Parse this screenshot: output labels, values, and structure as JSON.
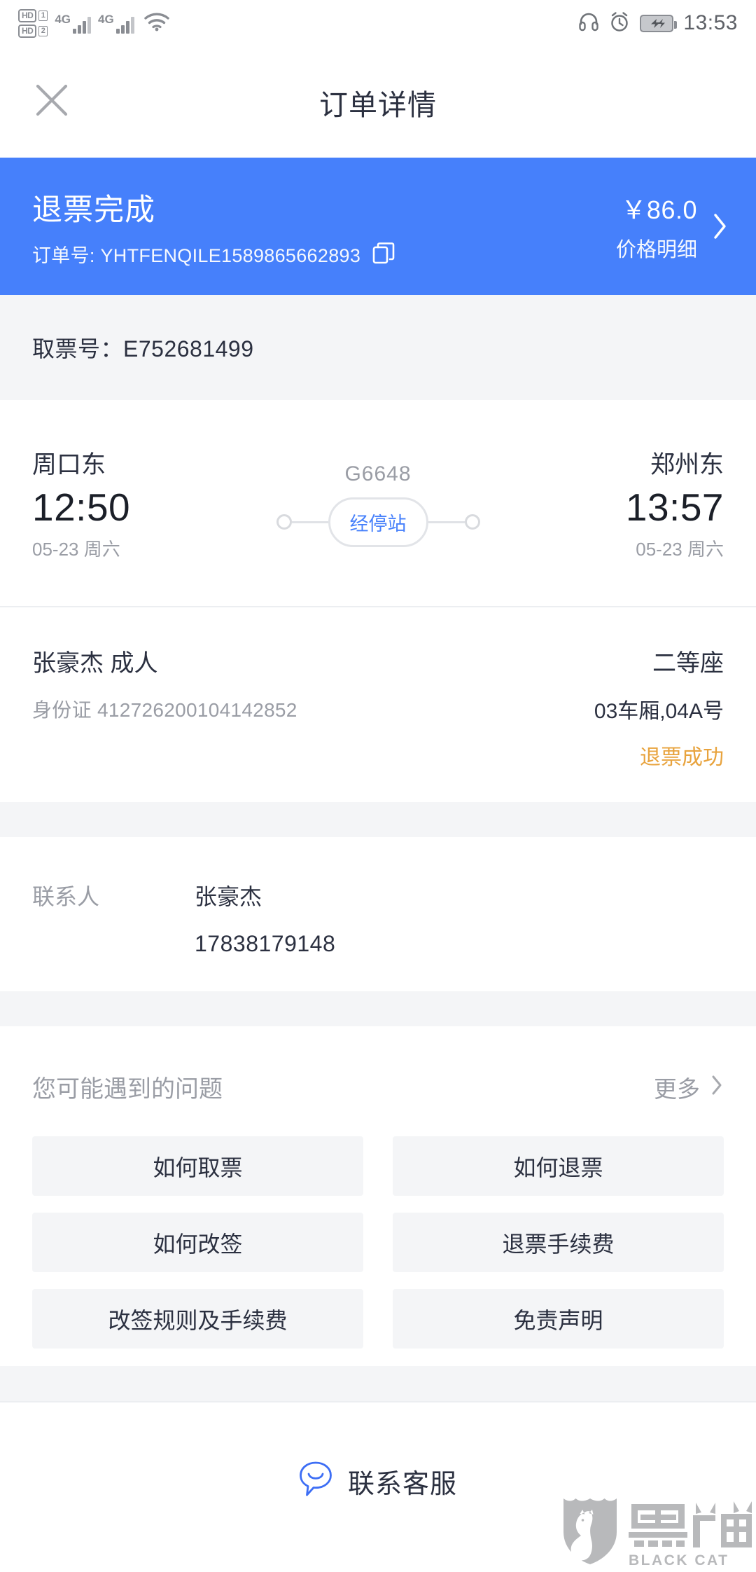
{
  "statusbar": {
    "hd1_label": "HD",
    "hd1_num": "1",
    "hd2_label": "HD",
    "hd2_num": "2",
    "net1": "4G",
    "net2": "4G",
    "time": "13:53",
    "icons": [
      "hd-icon",
      "signal-icon",
      "wifi-icon",
      "headphone-icon",
      "alarm-icon",
      "battery-charging-icon"
    ]
  },
  "header": {
    "title": "订单详情",
    "close_icon": "close-icon"
  },
  "banner": {
    "status": "退票完成",
    "order_label": "订单号:",
    "order_number": "YHTFENQILE1589865662893",
    "order_full": "订单号: YHTFENQILE1589865662893",
    "copy_icon": "copy-icon",
    "price": "￥86.0",
    "price_label": "价格明细",
    "chevron_icon": "chevron-right-icon",
    "accent_color": "#4680fb"
  },
  "pickup": {
    "text": "取票号：E752681499",
    "label": "取票号：",
    "value": "E752681499"
  },
  "train": {
    "train_number": "G6648",
    "stop_pill": "经停站",
    "departure": {
      "station": "周口东",
      "time": "12:50",
      "date": "05-23 周六"
    },
    "arrival": {
      "station": "郑州东",
      "time": "13:57",
      "date": "05-23 周六"
    }
  },
  "passenger": {
    "name": "张豪杰 成人",
    "id_label": "身份证",
    "id_number": "412726200104142852",
    "id_full": "身份证 412726200104142852",
    "seat_class": "二等座",
    "seat_no": "03车厢,04A号",
    "status": "退票成功",
    "status_color": "#e8a33d"
  },
  "contact": {
    "label": "联系人",
    "name": "张豪杰",
    "phone": "17838179148"
  },
  "faq": {
    "title": "您可能遇到的问题",
    "more_label": "更多",
    "more_icon": "chevron-right-icon",
    "items": [
      {
        "label": "如何取票"
      },
      {
        "label": "如何退票"
      },
      {
        "label": "如何改签"
      },
      {
        "label": "退票手续费"
      },
      {
        "label": "改签规则及手续费"
      },
      {
        "label": "免责声明"
      }
    ]
  },
  "bottom": {
    "service_label": "联系客服",
    "service_icon": "chat-bubble-icon"
  },
  "watermark": {
    "cn_text": "黑猫",
    "en_text": "BLACK CAT",
    "logo_icon": "black-cat-shield-icon"
  }
}
